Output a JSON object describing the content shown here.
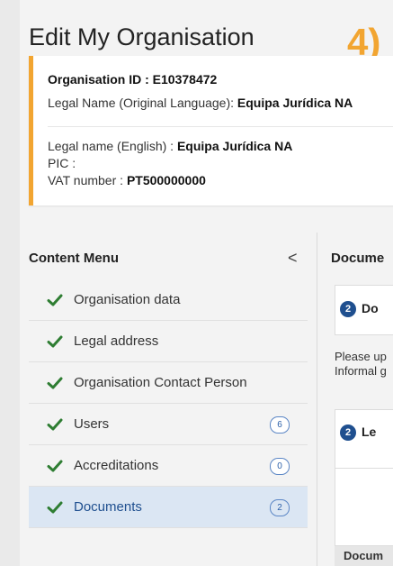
{
  "page": {
    "title": "Edit My Organisation",
    "step_badge": "4)"
  },
  "organisation": {
    "id_label": "Organisation ID : E10378472",
    "legal_name_original_label": "Legal Name (Original Language): ",
    "legal_name_original_value": "Equipa Jurídica NA",
    "legal_name_english_label": "Legal name (English) : ",
    "legal_name_english_value": "Equipa Jurídica NA",
    "pic_label": "PIC :",
    "vat_label": "VAT number : ",
    "vat_value": "PT500000000"
  },
  "content_menu": {
    "header": "Content Menu",
    "collapse_glyph": "<",
    "items": [
      {
        "label": "Organisation data",
        "icon": "check-icon"
      },
      {
        "label": "Legal address",
        "icon": "check-icon"
      },
      {
        "label": "Organisation Contact Person",
        "icon": "check-icon"
      },
      {
        "label": "Users",
        "icon": "check-icon",
        "count": "6"
      },
      {
        "label": "Accreditations",
        "icon": "check-icon",
        "count": "0"
      },
      {
        "label": "Documents",
        "icon": "check-icon",
        "count": "2",
        "active": true
      }
    ]
  },
  "documents_panel": {
    "title": "Docume",
    "section1_number": "2",
    "section1_label": "Do",
    "note_line1": "Please up",
    "note_line2": "Informal g",
    "section2_number": "2",
    "section2_label": "Le",
    "table_header": "Docum"
  },
  "colors": {
    "accent": "#f2a531",
    "primary": "#1f4f8f",
    "check": "#2e7d32",
    "active_bg": "#dbe6f3"
  }
}
